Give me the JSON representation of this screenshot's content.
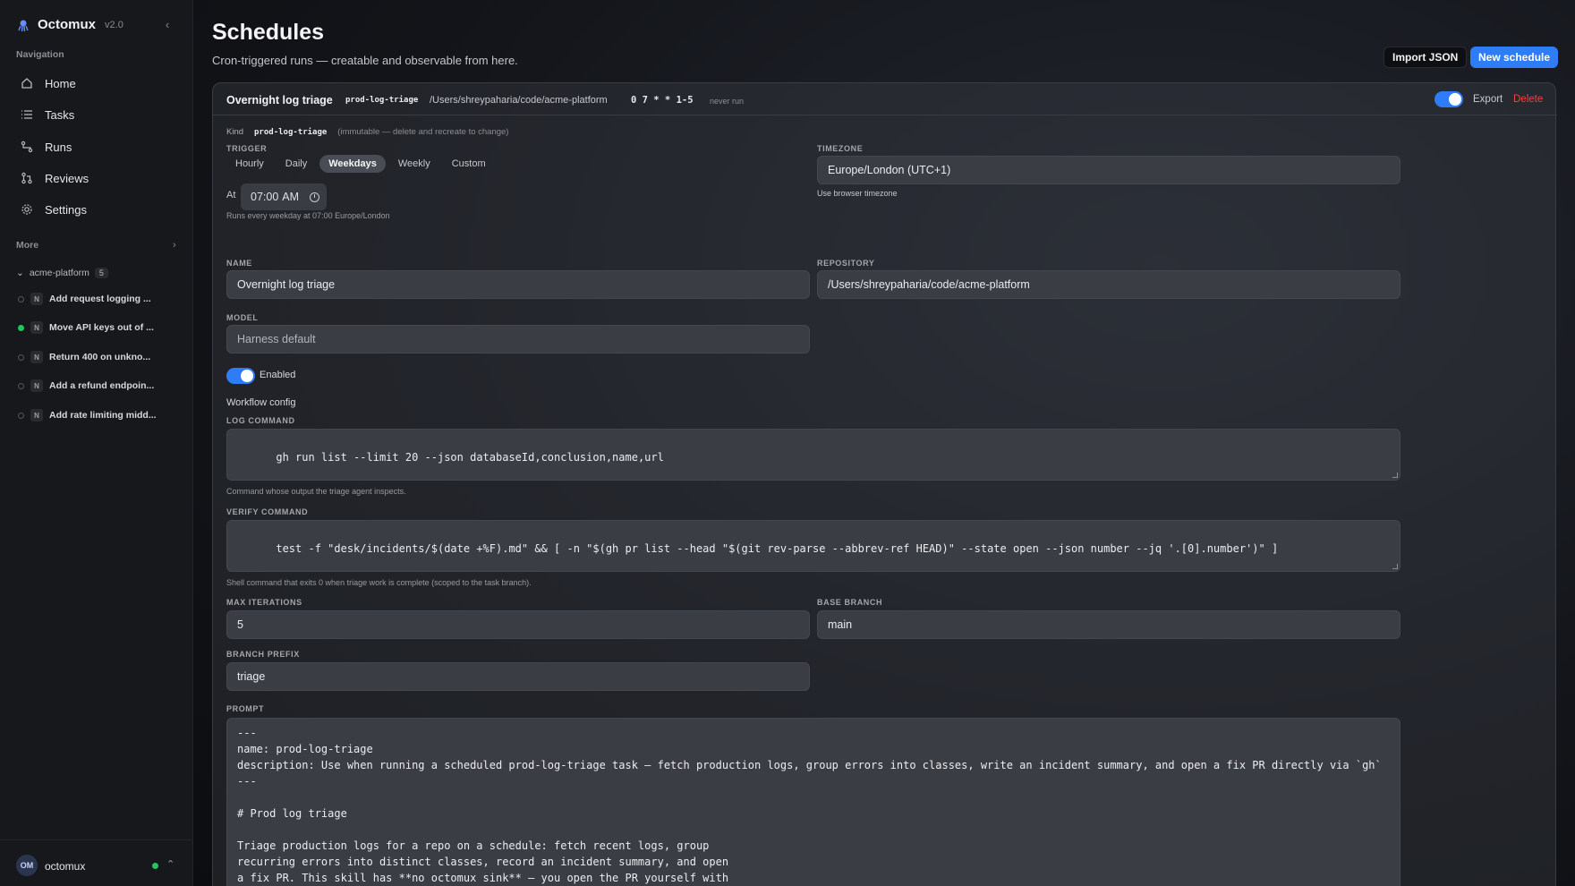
{
  "app": {
    "name": "Octomux",
    "version": "v2.0"
  },
  "sidebar": {
    "navigation_label": "Navigation",
    "nav": [
      {
        "label": "Home",
        "icon": "home-icon"
      },
      {
        "label": "Tasks",
        "icon": "list-icon"
      },
      {
        "label": "Runs",
        "icon": "runs-icon"
      },
      {
        "label": "Reviews",
        "icon": "reviews-icon"
      },
      {
        "label": "Settings",
        "icon": "gear-icon"
      }
    ],
    "more_label": "More",
    "group": {
      "name": "acme-platform",
      "count": "5"
    },
    "tasks": [
      {
        "badge": "N",
        "label": "Add request logging ...",
        "active": false
      },
      {
        "badge": "N",
        "label": "Move API keys out of ...",
        "active": true
      },
      {
        "badge": "N",
        "label": "Return 400 on unkno...",
        "active": false
      },
      {
        "badge": "N",
        "label": "Add a refund endpoin...",
        "active": false
      },
      {
        "badge": "N",
        "label": "Add rate limiting midd...",
        "active": false
      }
    ],
    "user": {
      "initials": "OM",
      "name": "octomux"
    }
  },
  "header": {
    "title": "Schedules",
    "subtitle": "Cron-triggered runs — creatable and observable from here.",
    "import_label": "Import JSON",
    "new_label": "New schedule"
  },
  "schedule": {
    "title": "Overnight log triage",
    "kind": "prod-log-triage",
    "repo": "/Users/shreypaharia/code/acme-platform",
    "cron": "0 7 * * 1-5",
    "last_run": "never run",
    "export_label": "Export",
    "delete_label": "Delete",
    "kind_label": "Kind",
    "kind_note": "(immutable — delete and recreate to change)",
    "trigger_label": "TRIGGER",
    "trigger_options": [
      "Hourly",
      "Daily",
      "Weekdays",
      "Weekly",
      "Custom"
    ],
    "trigger_selected": "Weekdays",
    "at_label": "At",
    "time": "07:00",
    "ampm": "AM",
    "trigger_hint": "Runs every weekday at 07:00 Europe/London",
    "timezone_label": "TIMEZONE",
    "timezone": "Europe/London (UTC+1)",
    "timezone_hint": "Use browser timezone",
    "name_label": "NAME",
    "name": "Overnight log triage",
    "repository_label": "REPOSITORY",
    "repository": "/Users/shreypaharia/code/acme-platform",
    "model_label": "MODEL",
    "model_placeholder": "Harness default",
    "enabled_label": "Enabled",
    "workflow_title": "Workflow config",
    "log_command_label": "LOG COMMAND",
    "log_command": "gh run list --limit 20 --json databaseId,conclusion,name,url",
    "log_command_hint": "Command whose output the triage agent inspects.",
    "verify_command_label": "VERIFY COMMAND",
    "verify_command": "test -f \"desk/incidents/$(date +%F).md\" && [ -n \"$(gh pr list --head \"$(git rev-parse --abbrev-ref HEAD)\" --state open --json number --jq '.[0].number')\" ]",
    "verify_command_hint": "Shell command that exits 0 when triage work is complete (scoped to the task branch).",
    "max_iterations_label": "MAX ITERATIONS",
    "max_iterations": "5",
    "base_branch_label": "BASE BRANCH",
    "base_branch": "main",
    "branch_prefix_label": "BRANCH PREFIX",
    "branch_prefix": "triage",
    "prompt_label": "PROMPT",
    "prompt": "---\nname: prod-log-triage\ndescription: Use when running a scheduled prod-log-triage task — fetch production logs, group errors into classes, write an incident summary, and open a fix PR directly via `gh`\n---\n\n# Prod log triage\n\nTriage production logs for a repo on a schedule: fetch recent logs, group\nrecurring errors into distinct classes, record an incident summary, and open\na fix PR. This skill has **no octomux sink** — you open the PR yourself with"
  },
  "colors": {
    "accent": "#2f7df6",
    "danger": "#ef4444",
    "status_ok": "#22c55e"
  }
}
